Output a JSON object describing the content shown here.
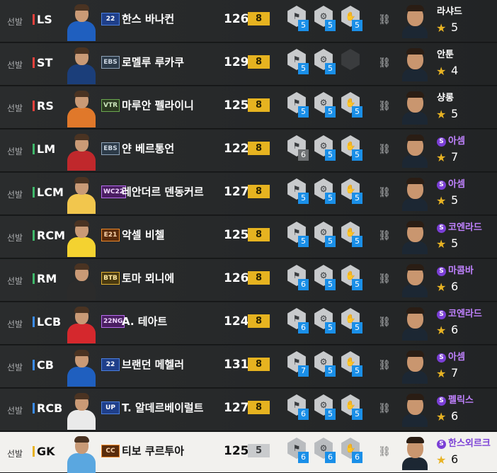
{
  "players": [
    {
      "role": "선발",
      "pos": "LS",
      "pos_color": "#e8413c",
      "season": "22",
      "season_style": "blue",
      "name": "한스 바나컨",
      "ovr": "126",
      "grade": "8",
      "kit": "#1f5fbf",
      "traits": [
        {
          "icon": "trait-icon",
          "level": "5"
        },
        {
          "icon": "trait-icon",
          "level": "5"
        },
        {
          "icon": "trait-icon",
          "level": "5"
        }
      ],
      "coach": "라샤드",
      "coach_special": false,
      "stars": "5"
    },
    {
      "role": "선발",
      "pos": "ST",
      "pos_color": "#e8413c",
      "season": "EBS",
      "season_style": "grey",
      "name": "로멜루 루카쿠",
      "ovr": "129",
      "grade": "8",
      "kit": "#1b3e7a",
      "traits": [
        {
          "icon": "trait-icon",
          "level": "5"
        },
        {
          "icon": "trait-icon",
          "level": "5"
        },
        {
          "icon": "empty",
          "level": ""
        }
      ],
      "coach": "안툰",
      "coach_special": false,
      "stars": "4"
    },
    {
      "role": "선발",
      "pos": "RS",
      "pos_color": "#e8413c",
      "season": "VTR",
      "season_style": "green",
      "name": "마루안 펠라이니",
      "ovr": "125",
      "grade": "8",
      "kit": "#e0782a",
      "traits": [
        {
          "icon": "trait-icon",
          "level": "5"
        },
        {
          "icon": "trait-icon",
          "level": "5"
        },
        {
          "icon": "trait-icon",
          "level": "5"
        }
      ],
      "coach": "샹롱",
      "coach_special": false,
      "stars": "5"
    },
    {
      "role": "선발",
      "pos": "LM",
      "pos_color": "#3fb86a",
      "season": "EBS",
      "season_style": "grey",
      "name": "얀 베르통언",
      "ovr": "122",
      "grade": "8",
      "kit": "#c0282c",
      "traits": [
        {
          "icon": "trait-icon",
          "level": "6",
          "grey": true
        },
        {
          "icon": "trait-icon",
          "level": "5"
        },
        {
          "icon": "trait-icon",
          "level": "5"
        }
      ],
      "coach": "아셈",
      "coach_special": true,
      "stars": "7"
    },
    {
      "role": "선발",
      "pos": "LCM",
      "pos_color": "#3fb86a",
      "season": "WC22",
      "season_style": "purple",
      "name": "레안더르 덴동커르",
      "ovr": "127",
      "grade": "8",
      "kit": "#f2c64d",
      "traits": [
        {
          "icon": "trait-icon",
          "level": "5"
        },
        {
          "icon": "trait-icon",
          "level": "5"
        },
        {
          "icon": "trait-icon",
          "level": "5"
        }
      ],
      "coach": "아셈",
      "coach_special": true,
      "stars": "5"
    },
    {
      "role": "선발",
      "pos": "RCM",
      "pos_color": "#3fb86a",
      "season": "E21",
      "season_style": "orange",
      "name": "악셀 비첼",
      "ovr": "125",
      "grade": "8",
      "kit": "#f4d230",
      "traits": [
        {
          "icon": "trait-icon",
          "level": "5"
        },
        {
          "icon": "trait-icon",
          "level": "5"
        },
        {
          "icon": "trait-icon",
          "level": "5"
        }
      ],
      "coach": "코엔라드",
      "coach_special": true,
      "stars": "5"
    },
    {
      "role": "선발",
      "pos": "RM",
      "pos_color": "#3fb86a",
      "season": "BTB",
      "season_style": "gold",
      "name": "토마 뫼니에",
      "ovr": "126",
      "grade": "8",
      "kit": "#2b2b2b",
      "traits": [
        {
          "icon": "trait-icon",
          "level": "6"
        },
        {
          "icon": "trait-icon",
          "level": "5"
        },
        {
          "icon": "trait-icon",
          "level": "5"
        }
      ],
      "coach": "마콤바",
      "coach_special": true,
      "stars": "6"
    },
    {
      "role": "선발",
      "pos": "LCB",
      "pos_color": "#3a8cf0",
      "season": "22NG",
      "season_style": "purple",
      "name": "A. 테아트",
      "ovr": "124",
      "grade": "8",
      "kit": "#d5282d",
      "traits": [
        {
          "icon": "trait-icon",
          "level": "6"
        },
        {
          "icon": "trait-icon",
          "level": "5"
        },
        {
          "icon": "trait-icon",
          "level": "5"
        }
      ],
      "coach": "코엔라드",
      "coach_special": true,
      "stars": "6"
    },
    {
      "role": "선발",
      "pos": "CB",
      "pos_color": "#3a8cf0",
      "season": "22",
      "season_style": "blue",
      "name": "브랜던 메헬러",
      "ovr": "131",
      "grade": "8",
      "kit": "#1f5fbf",
      "traits": [
        {
          "icon": "trait-icon",
          "level": "7"
        },
        {
          "icon": "trait-icon",
          "level": "5"
        },
        {
          "icon": "trait-icon",
          "level": "5"
        }
      ],
      "coach": "아셈",
      "coach_special": true,
      "stars": "7"
    },
    {
      "role": "선발",
      "pos": "RCB",
      "pos_color": "#3a8cf0",
      "season": "UP",
      "season_style": "blue",
      "name": "T. 알데르베이럴트",
      "ovr": "127",
      "grade": "8",
      "kit": "#eaeaea",
      "traits": [
        {
          "icon": "trait-icon",
          "level": "6"
        },
        {
          "icon": "trait-icon",
          "level": "5"
        },
        {
          "icon": "trait-icon",
          "level": "5"
        }
      ],
      "coach": "펠릭스",
      "coach_special": true,
      "stars": "6"
    },
    {
      "role": "선발",
      "pos": "GK",
      "pos_color": "#e8b323",
      "season": "CC",
      "season_style": "orange",
      "name": "티보 쿠르투아",
      "ovr": "125",
      "grade": "5",
      "kit": "#5aa7e0",
      "traits": [
        {
          "icon": "trait-icon",
          "level": "6"
        },
        {
          "icon": "trait-icon",
          "level": "6"
        },
        {
          "icon": "trait-icon",
          "level": "6"
        }
      ],
      "coach": "한스외르크",
      "coach_special": true,
      "stars": "6",
      "light": true
    }
  ],
  "icons": {
    "link": "link-icon",
    "star": "star-icon",
    "special_badge": "S"
  }
}
